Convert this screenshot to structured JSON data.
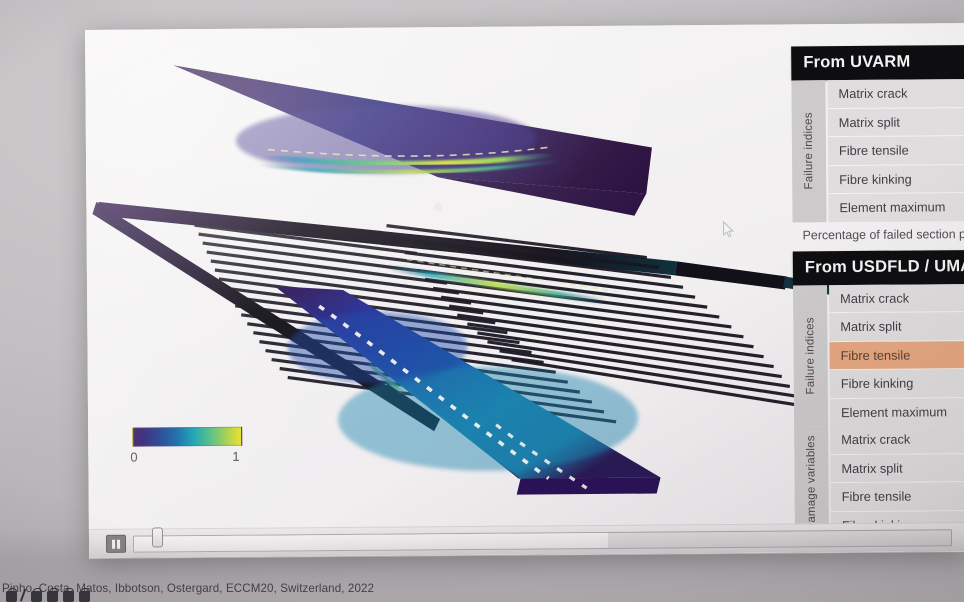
{
  "caption": {
    "text": "Pinho, Costa, Matos, Ibbotson, Ostergard, ECCM20, Switzerland, 2022"
  },
  "slide": {
    "colorbar": {
      "min_label": "0",
      "max_label": "1",
      "gradient": [
        "#3c1a63",
        "#2d1f73",
        "#1f3d8f",
        "#1567a6",
        "#179fb4",
        "#4dbb8a",
        "#a3cf4f",
        "#e8e226"
      ]
    },
    "playback": {
      "pause_icon": "pause-icon",
      "progress_percent": 58,
      "handle_percent": 2
    },
    "tables": [
      {
        "id": "uvarm",
        "header": "From UVARM",
        "groups": [
          {
            "label": "Failure indices",
            "rows": [
              {
                "label": "Matrix crack",
                "highlighted": false
              },
              {
                "label": "Matrix split",
                "highlighted": false
              },
              {
                "label": "Fibre tensile",
                "highlighted": false
              },
              {
                "label": "Fibre kinking",
                "highlighted": false
              },
              {
                "label": "Element maximum",
                "highlighted": false
              }
            ]
          }
        ],
        "note": "Percentage of failed section po"
      },
      {
        "id": "usdfld-umat",
        "header": "From USDFLD / UMA",
        "groups": [
          {
            "label": "Failure indices",
            "rows": [
              {
                "label": "Matrix crack",
                "highlighted": false
              },
              {
                "label": "Matrix split",
                "highlighted": false
              },
              {
                "label": "Fibre tensile",
                "highlighted": true
              },
              {
                "label": "Fibre kinking",
                "highlighted": false
              },
              {
                "label": "Element maximum",
                "highlighted": false
              }
            ]
          },
          {
            "label": "Damage variables",
            "rows": [
              {
                "label": "Matrix crack",
                "highlighted": false
              },
              {
                "label": "Matrix split",
                "highlighted": false
              },
              {
                "label": "Fibre tensile",
                "highlighted": false
              },
              {
                "label": "Fibre kinking",
                "highlighted": false
              }
            ]
          }
        ],
        "note": ""
      }
    ]
  },
  "colors": {
    "header_background": "#0e0d0f",
    "header_text": "#f4f3f4",
    "row_background": "#dfdddd",
    "row_highlight": "#e6a77f",
    "group_label_background": "#cccaca",
    "slide_background": "#f2f0f1",
    "wall": "#c3c0c3"
  }
}
